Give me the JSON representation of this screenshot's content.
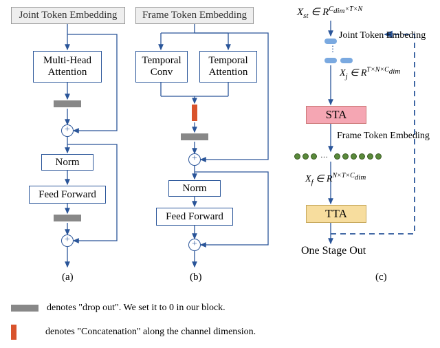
{
  "panelA": {
    "header": "Joint Token Embedding",
    "mha": "Multi-Head\nAttention",
    "norm": "Norm",
    "ff": "Feed Forward",
    "caption": "(a)"
  },
  "panelB": {
    "header": "Frame Token Embedding",
    "tconv": "Temporal\nConv",
    "tattn": "Temporal\nAttention",
    "norm": "Norm",
    "ff": "Feed Forward",
    "caption": "(b)"
  },
  "panelC": {
    "input_expr": "Xₛₜ ∈ R",
    "input_sup": "C₍dim₎ × T × N",
    "jte": "Joint Token Embeding",
    "xj_expr": "Xⱼ ∈ R",
    "xj_sup": "T × N × C₍dim₎",
    "sta": "STA",
    "fte": "Frame Token Embeding",
    "xf_expr": "X_f ∈ R",
    "xf_sup": "N × T × C₍dim₎",
    "tta": "TTA",
    "out": "One Stage Out",
    "caption": "(c)"
  },
  "legend": {
    "grey": "denotes \"drop out\". We set it to 0 in our block.",
    "orange": "denotes \"Concatenation\" along the channel dimension."
  }
}
